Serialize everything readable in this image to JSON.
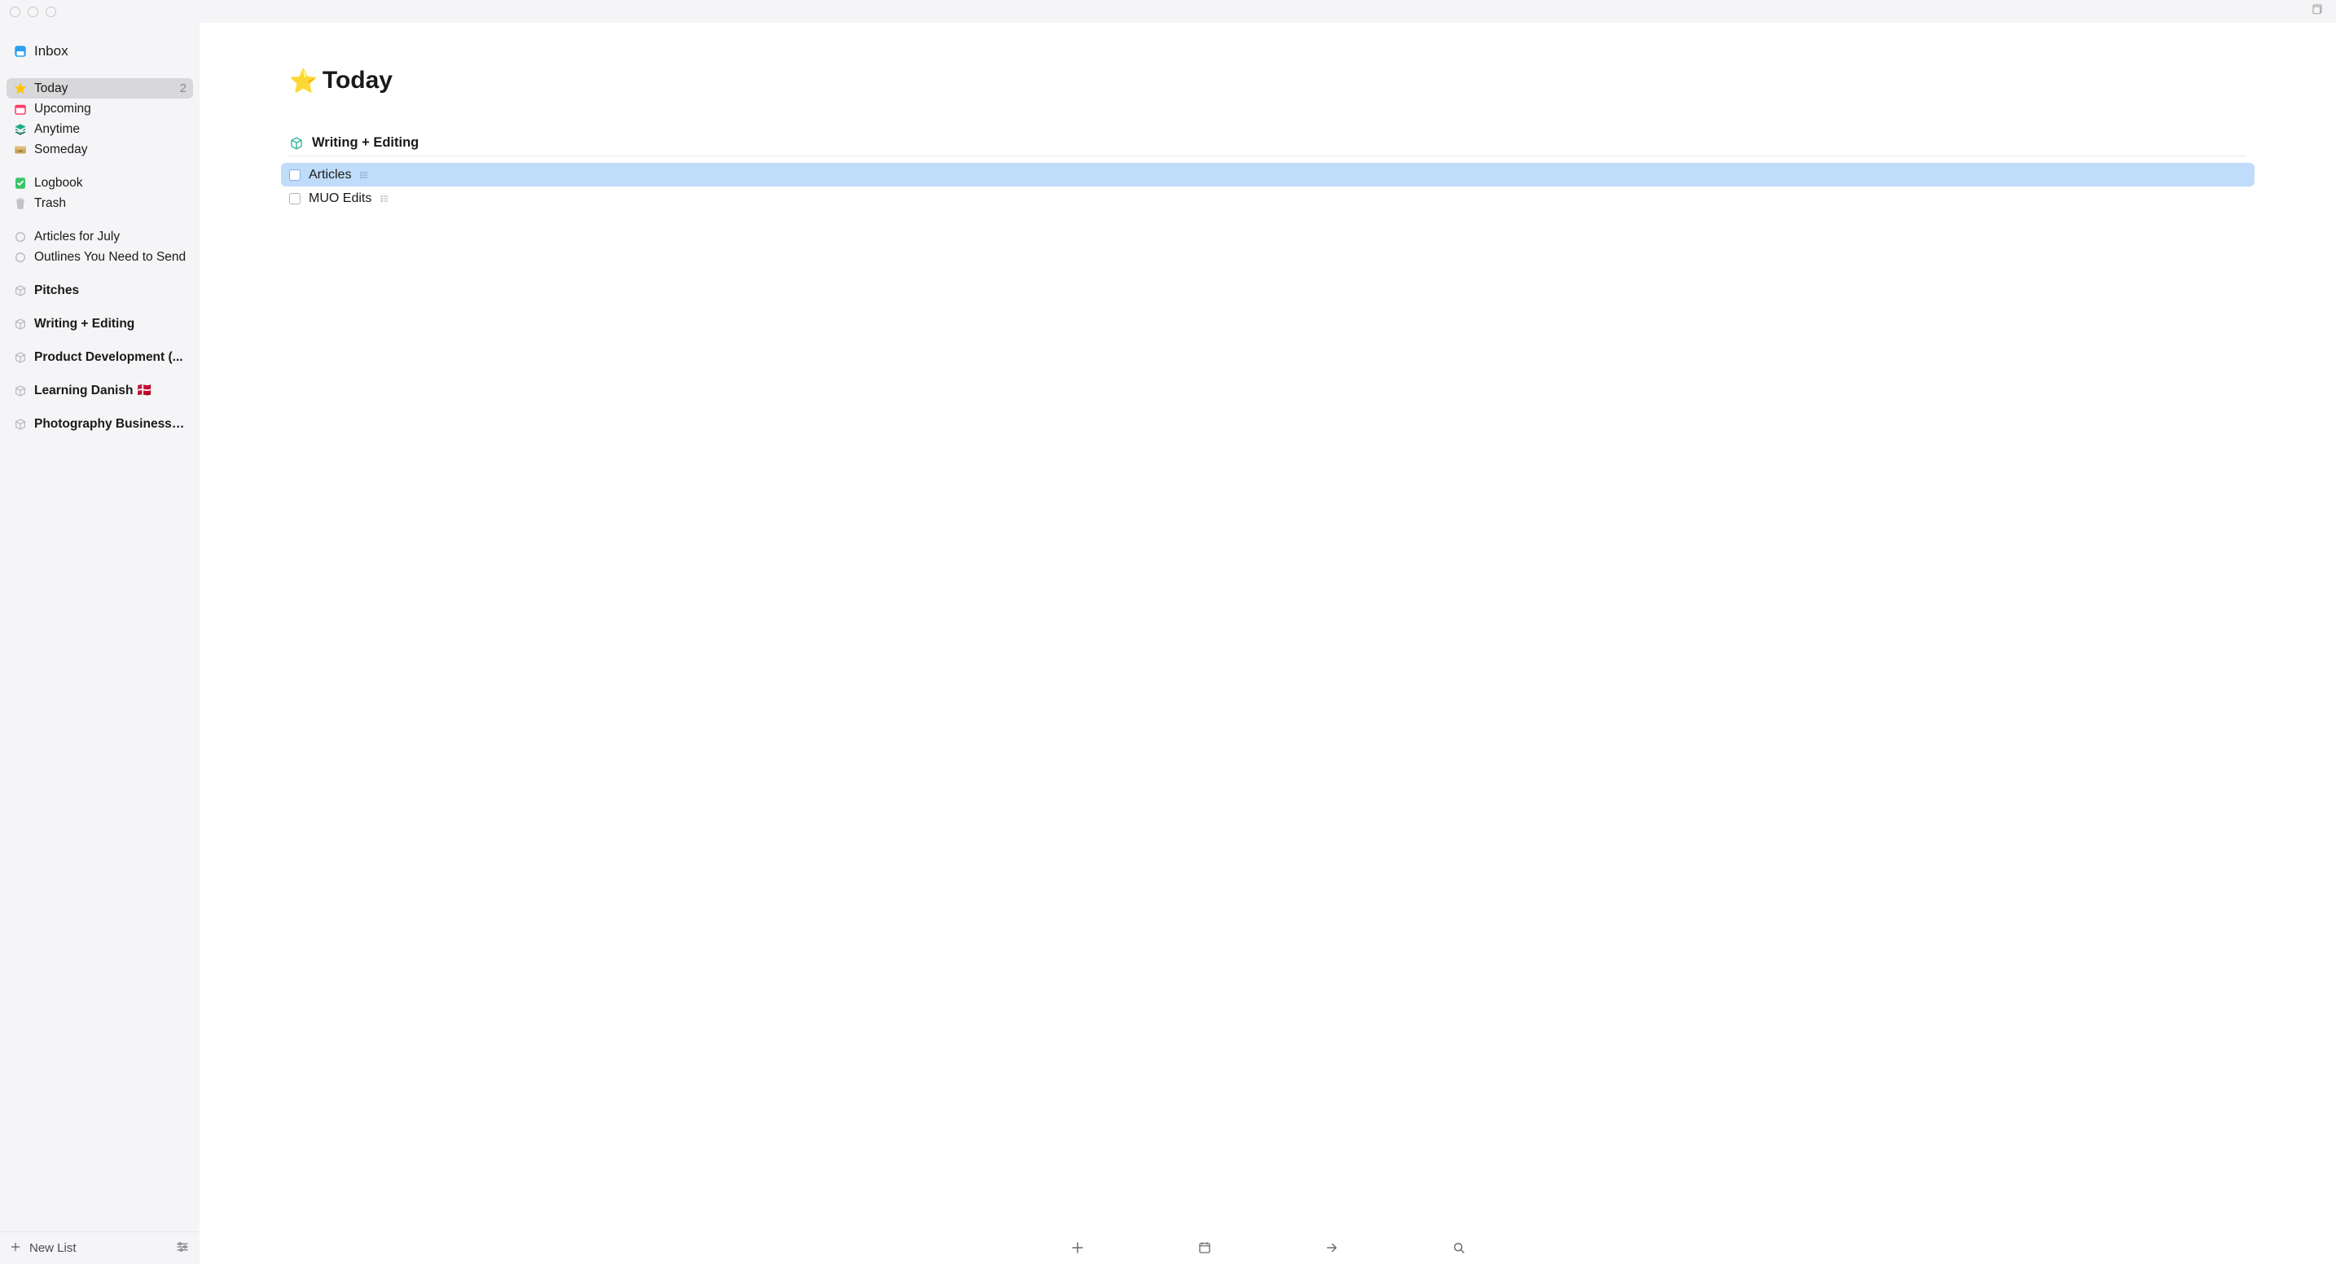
{
  "window": {
    "open_new_window_icon": "open-new-window-icon"
  },
  "sidebar": {
    "inbox": {
      "label": "Inbox"
    },
    "items_main": [
      {
        "label": "Today",
        "count": "2",
        "selected": true,
        "name": "today"
      },
      {
        "label": "Upcoming",
        "count": "",
        "selected": false,
        "name": "upcoming"
      },
      {
        "label": "Anytime",
        "count": "",
        "selected": false,
        "name": "anytime"
      },
      {
        "label": "Someday",
        "count": "",
        "selected": false,
        "name": "someday"
      }
    ],
    "items_history": [
      {
        "label": "Logbook",
        "name": "logbook"
      },
      {
        "label": "Trash",
        "name": "trash"
      }
    ],
    "projects_raw": [
      {
        "label": "Articles for July",
        "name": "articles-for-july"
      },
      {
        "label": "Outlines You Need to Send",
        "name": "outlines-you-need-to-send"
      }
    ],
    "areas": [
      {
        "label": "Pitches",
        "name": "pitches"
      },
      {
        "label": "Writing + Editing",
        "name": "writing-editing"
      },
      {
        "label": "Product Development (...",
        "name": "product-development"
      },
      {
        "label": "Learning Danish 🇩🇰",
        "name": "learning-danish"
      },
      {
        "label": "Photography Business 📸",
        "name": "photography-business"
      }
    ],
    "footer": {
      "new_list_label": "New List"
    }
  },
  "page": {
    "title": "Today",
    "section": {
      "title": "Writing + Editing",
      "tasks": [
        {
          "label": "Articles",
          "selected": true,
          "has_subtasks": true,
          "name": "articles"
        },
        {
          "label": "MUO Edits",
          "selected": false,
          "has_subtasks": true,
          "name": "muo-edits"
        }
      ]
    }
  },
  "toolbar": {
    "new_todo": "new-todo-button",
    "schedule": "schedule-button",
    "move": "move-button",
    "search": "search-button"
  }
}
